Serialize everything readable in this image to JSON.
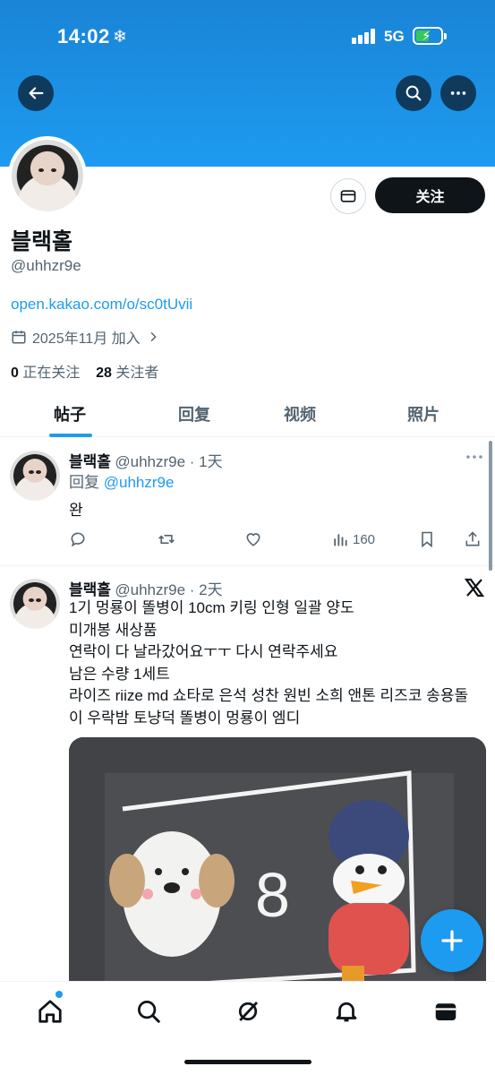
{
  "status_bar": {
    "time": "14:02",
    "snow_glyph": "❄",
    "network": "5G"
  },
  "profile": {
    "name": "블랙홀",
    "handle": "@uhhzr9e",
    "link": "open.kakao.com/o/sc0tUvii",
    "joined": "2025年11月 加入",
    "following_count": "0",
    "following_label": "正在关注",
    "followers_count": "28",
    "followers_label": "关注者",
    "follow_button": "关注"
  },
  "tabs": [
    "帖子",
    "回复",
    "视频",
    "照片"
  ],
  "tweets": [
    {
      "name": "블랙홀",
      "meta": "@uhhzr9e · 1天",
      "reply_prefix": "回复",
      "reply_to": "@uhhzr9e",
      "text": "완",
      "views": "160"
    },
    {
      "name": "블랙홀",
      "meta": "@uhhzr9e · 2天",
      "lines": [
        "1기 멍룡이 똘병이 10cm 키링 인형 일괄 양도",
        "미개봉 새상품",
        "연락이 다 날라갔어요ㅜㅜ 다시 연락주세요",
        "남은 수량 1세트",
        "라이즈 riize md 쇼타로 은석 성찬 원빈 소희 앤톤 리즈코 송용돌",
        "이 우락밤 토냥덕 똘병이 멍룡이 엠디"
      ],
      "photo_text": "8"
    }
  ],
  "icons": {
    "back": "arrow-left-icon",
    "search": "search-icon",
    "more": "more-icon",
    "message": "mail-icon",
    "calendar": "calendar-icon",
    "x_logo": "x-logo-icon",
    "fab": "plus-icon"
  },
  "colors": {
    "accent": "#1d9bf0",
    "banner": "#1d9bf0",
    "text": "#0f1419",
    "muted": "#536471"
  }
}
